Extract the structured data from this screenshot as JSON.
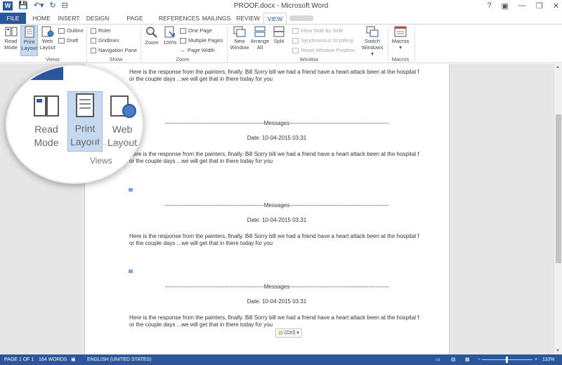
{
  "titlebar": {
    "title": "PROOF.docx - Microsoft Word",
    "help": "?",
    "controls": [
      "▣",
      "—",
      "❐",
      "✕"
    ]
  },
  "tabs": [
    "FILE",
    "HOME",
    "INSERT",
    "DESIGN",
    "PAGE LAYOUT",
    "REFERENCES",
    "MAILINGS",
    "REVIEW",
    "VIEW"
  ],
  "ribbon": {
    "views": {
      "label": "Views",
      "read_mode": [
        "Read",
        "Mode"
      ],
      "print_layout": [
        "Print",
        "Layout"
      ],
      "web_layout": [
        "Web",
        "Layout"
      ],
      "outline": "Outline",
      "draft": "Draft"
    },
    "show": {
      "label": "Show",
      "ruler": "Ruler",
      "gridlines": "Gridlines",
      "nav_pane": "Navigation Pane"
    },
    "zoom": {
      "label": "Zoom",
      "zoom": "Zoom",
      "hundred": "100%",
      "one_page": "One Page",
      "multiple_pages": "Multiple Pages",
      "page_width": "Page Width"
    },
    "window": {
      "label": "Window",
      "new_window": [
        "New",
        "Window"
      ],
      "arrange_all": [
        "Arrange",
        "All"
      ],
      "split": "Split",
      "view_side": "View Side by Side",
      "sync_scroll": "Synchronous Scrolling",
      "reset_pos": "Reset Window Position",
      "switch_windows": [
        "Switch",
        "Windows ▾"
      ]
    },
    "macros": {
      "label": "Macros",
      "macros": [
        "Macros",
        "▾"
      ]
    }
  },
  "document": {
    "paragraph_line1": "Here is the response from the painters, finally. Bill Sorry bill we had a friend have a heart attack been at the hospital f",
    "paragraph_line2": "or the couple days ...we will get that in there today for you",
    "messages_header": "-----------------------------------------------------Messages-----------------------------------------------------",
    "date_line": "Date: 10-04-2015 03:31",
    "paste_options": "(Ctrl) ▾"
  },
  "magnifier": {
    "read_mode": [
      "Read",
      "Mode"
    ],
    "print_layout": [
      "Print",
      "Layout"
    ],
    "web_layout": [
      "Web",
      "Layout"
    ],
    "group_label": "Views"
  },
  "statusbar": {
    "page": "PAGE 1 OF 1",
    "words": "164 WORDS",
    "language": "ENGLISH (UNITED STATES)",
    "zoom_minus": "−",
    "zoom_plus": "+",
    "zoom_level": "110%"
  }
}
